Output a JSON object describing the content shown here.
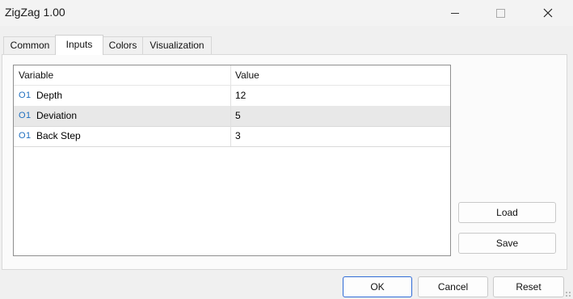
{
  "window": {
    "title": "ZigZag 1.00",
    "controls": {
      "minimize": "minimize-icon",
      "maximize": "maximize-icon",
      "close": "close-icon"
    }
  },
  "tabs": [
    {
      "label": "Common",
      "active": false
    },
    {
      "label": "Inputs",
      "active": true
    },
    {
      "label": "Colors",
      "active": false
    },
    {
      "label": "Visualization",
      "active": false
    }
  ],
  "grid": {
    "headers": {
      "variable": "Variable",
      "value": "Value"
    },
    "rows": [
      {
        "icon": "O1",
        "variable": "Depth",
        "value": "12",
        "selected": false
      },
      {
        "icon": "O1",
        "variable": "Deviation",
        "value": "5",
        "selected": true
      },
      {
        "icon": "O1",
        "variable": "Back Step",
        "value": "3",
        "selected": false
      }
    ]
  },
  "side_buttons": {
    "load": "Load",
    "save": "Save"
  },
  "footer_buttons": {
    "ok": "OK",
    "cancel": "Cancel",
    "reset": "Reset"
  },
  "colors": {
    "accent": "#2f6bd6",
    "icon": "#1f6fbf",
    "selected_row": "#e8e8e8"
  }
}
